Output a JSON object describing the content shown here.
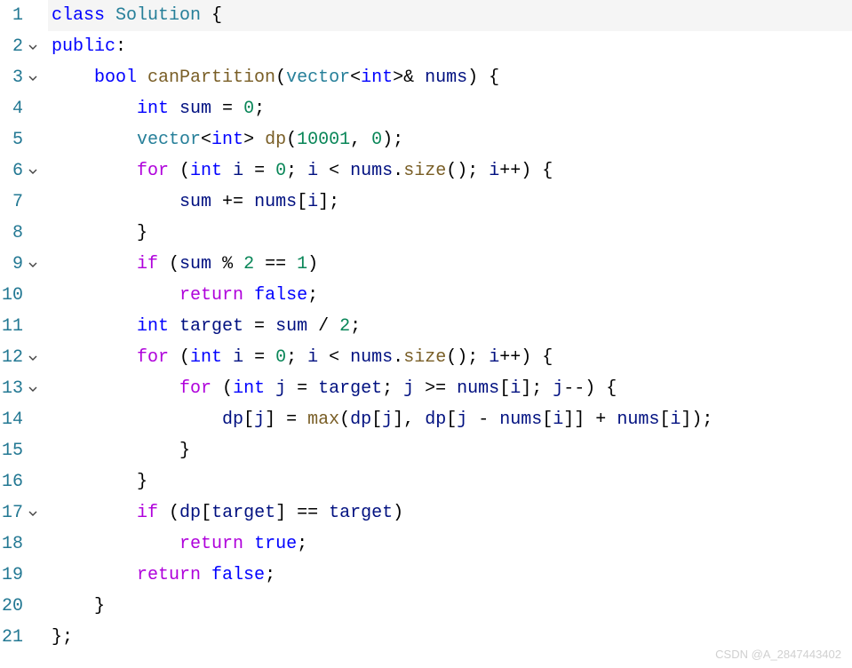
{
  "lines": [
    {
      "num": "1",
      "fold": "",
      "tokens": [
        {
          "t": "class ",
          "c": "kw"
        },
        {
          "t": "Solution",
          "c": "type"
        },
        {
          "t": " {",
          "c": "punct"
        }
      ],
      "hl": true
    },
    {
      "num": "2",
      "fold": "v",
      "tokens": [
        {
          "t": "public",
          "c": "kw"
        },
        {
          "t": ":",
          "c": "punct"
        }
      ]
    },
    {
      "num": "3",
      "fold": "v",
      "tokens": [
        {
          "t": "    ",
          "c": ""
        },
        {
          "t": "bool ",
          "c": "kw"
        },
        {
          "t": "canPartition",
          "c": "fn"
        },
        {
          "t": "(",
          "c": "punct"
        },
        {
          "t": "vector",
          "c": "type"
        },
        {
          "t": "<",
          "c": "punct"
        },
        {
          "t": "int",
          "c": "kw"
        },
        {
          "t": ">& ",
          "c": "punct"
        },
        {
          "t": "nums",
          "c": "var"
        },
        {
          "t": ") {",
          "c": "punct"
        }
      ]
    },
    {
      "num": "4",
      "fold": "",
      "tokens": [
        {
          "t": "        ",
          "c": ""
        },
        {
          "t": "int ",
          "c": "kw"
        },
        {
          "t": "sum",
          "c": "var"
        },
        {
          "t": " = ",
          "c": "op"
        },
        {
          "t": "0",
          "c": "num"
        },
        {
          "t": ";",
          "c": "punct"
        }
      ]
    },
    {
      "num": "5",
      "fold": "",
      "tokens": [
        {
          "t": "        ",
          "c": ""
        },
        {
          "t": "vector",
          "c": "type"
        },
        {
          "t": "<",
          "c": "punct"
        },
        {
          "t": "int",
          "c": "kw"
        },
        {
          "t": "> ",
          "c": "punct"
        },
        {
          "t": "dp",
          "c": "fn"
        },
        {
          "t": "(",
          "c": "punct"
        },
        {
          "t": "10001",
          "c": "num"
        },
        {
          "t": ", ",
          "c": "punct"
        },
        {
          "t": "0",
          "c": "num"
        },
        {
          "t": ");",
          "c": "punct"
        }
      ]
    },
    {
      "num": "6",
      "fold": "v",
      "tokens": [
        {
          "t": "        ",
          "c": ""
        },
        {
          "t": "for",
          "c": "ctrl"
        },
        {
          "t": " (",
          "c": "punct"
        },
        {
          "t": "int ",
          "c": "kw"
        },
        {
          "t": "i",
          "c": "var"
        },
        {
          "t": " = ",
          "c": "op"
        },
        {
          "t": "0",
          "c": "num"
        },
        {
          "t": "; ",
          "c": "punct"
        },
        {
          "t": "i",
          "c": "var"
        },
        {
          "t": " < ",
          "c": "op"
        },
        {
          "t": "nums",
          "c": "var"
        },
        {
          "t": ".",
          "c": "punct"
        },
        {
          "t": "size",
          "c": "fn"
        },
        {
          "t": "(); ",
          "c": "punct"
        },
        {
          "t": "i",
          "c": "var"
        },
        {
          "t": "++) {",
          "c": "punct"
        }
      ]
    },
    {
      "num": "7",
      "fold": "",
      "tokens": [
        {
          "t": "            ",
          "c": ""
        },
        {
          "t": "sum",
          "c": "var"
        },
        {
          "t": " += ",
          "c": "op"
        },
        {
          "t": "nums",
          "c": "var"
        },
        {
          "t": "[",
          "c": "punct"
        },
        {
          "t": "i",
          "c": "var"
        },
        {
          "t": "];",
          "c": "punct"
        }
      ]
    },
    {
      "num": "8",
      "fold": "",
      "tokens": [
        {
          "t": "        }",
          "c": "punct"
        }
      ]
    },
    {
      "num": "9",
      "fold": "v",
      "tokens": [
        {
          "t": "        ",
          "c": ""
        },
        {
          "t": "if",
          "c": "ctrl"
        },
        {
          "t": " (",
          "c": "punct"
        },
        {
          "t": "sum",
          "c": "var"
        },
        {
          "t": " % ",
          "c": "op"
        },
        {
          "t": "2",
          "c": "num"
        },
        {
          "t": " == ",
          "c": "op"
        },
        {
          "t": "1",
          "c": "num"
        },
        {
          "t": ")",
          "c": "punct"
        }
      ]
    },
    {
      "num": "10",
      "fold": "",
      "tokens": [
        {
          "t": "            ",
          "c": ""
        },
        {
          "t": "return",
          "c": "ctrl"
        },
        {
          "t": " ",
          "c": ""
        },
        {
          "t": "false",
          "c": "kw"
        },
        {
          "t": ";",
          "c": "punct"
        }
      ]
    },
    {
      "num": "11",
      "fold": "",
      "tokens": [
        {
          "t": "        ",
          "c": ""
        },
        {
          "t": "int ",
          "c": "kw"
        },
        {
          "t": "target",
          "c": "var"
        },
        {
          "t": " = ",
          "c": "op"
        },
        {
          "t": "sum",
          "c": "var"
        },
        {
          "t": " / ",
          "c": "op"
        },
        {
          "t": "2",
          "c": "num"
        },
        {
          "t": ";",
          "c": "punct"
        }
      ]
    },
    {
      "num": "12",
      "fold": "v",
      "tokens": [
        {
          "t": "        ",
          "c": ""
        },
        {
          "t": "for",
          "c": "ctrl"
        },
        {
          "t": " (",
          "c": "punct"
        },
        {
          "t": "int ",
          "c": "kw"
        },
        {
          "t": "i",
          "c": "var"
        },
        {
          "t": " = ",
          "c": "op"
        },
        {
          "t": "0",
          "c": "num"
        },
        {
          "t": "; ",
          "c": "punct"
        },
        {
          "t": "i",
          "c": "var"
        },
        {
          "t": " < ",
          "c": "op"
        },
        {
          "t": "nums",
          "c": "var"
        },
        {
          "t": ".",
          "c": "punct"
        },
        {
          "t": "size",
          "c": "fn"
        },
        {
          "t": "(); ",
          "c": "punct"
        },
        {
          "t": "i",
          "c": "var"
        },
        {
          "t": "++) {",
          "c": "punct"
        }
      ]
    },
    {
      "num": "13",
      "fold": "v",
      "tokens": [
        {
          "t": "            ",
          "c": ""
        },
        {
          "t": "for",
          "c": "ctrl"
        },
        {
          "t": " (",
          "c": "punct"
        },
        {
          "t": "int ",
          "c": "kw"
        },
        {
          "t": "j",
          "c": "var"
        },
        {
          "t": " = ",
          "c": "op"
        },
        {
          "t": "target",
          "c": "var"
        },
        {
          "t": "; ",
          "c": "punct"
        },
        {
          "t": "j",
          "c": "var"
        },
        {
          "t": " >= ",
          "c": "op"
        },
        {
          "t": "nums",
          "c": "var"
        },
        {
          "t": "[",
          "c": "punct"
        },
        {
          "t": "i",
          "c": "var"
        },
        {
          "t": "]; ",
          "c": "punct"
        },
        {
          "t": "j",
          "c": "var"
        },
        {
          "t": "--) {",
          "c": "punct"
        }
      ]
    },
    {
      "num": "14",
      "fold": "",
      "tokens": [
        {
          "t": "                ",
          "c": ""
        },
        {
          "t": "dp",
          "c": "var"
        },
        {
          "t": "[",
          "c": "punct"
        },
        {
          "t": "j",
          "c": "var"
        },
        {
          "t": "] = ",
          "c": "punct"
        },
        {
          "t": "max",
          "c": "fn"
        },
        {
          "t": "(",
          "c": "punct"
        },
        {
          "t": "dp",
          "c": "var"
        },
        {
          "t": "[",
          "c": "punct"
        },
        {
          "t": "j",
          "c": "var"
        },
        {
          "t": "], ",
          "c": "punct"
        },
        {
          "t": "dp",
          "c": "var"
        },
        {
          "t": "[",
          "c": "punct"
        },
        {
          "t": "j",
          "c": "var"
        },
        {
          "t": " - ",
          "c": "op"
        },
        {
          "t": "nums",
          "c": "var"
        },
        {
          "t": "[",
          "c": "punct"
        },
        {
          "t": "i",
          "c": "var"
        },
        {
          "t": "]] + ",
          "c": "punct"
        },
        {
          "t": "nums",
          "c": "var"
        },
        {
          "t": "[",
          "c": "punct"
        },
        {
          "t": "i",
          "c": "var"
        },
        {
          "t": "]);",
          "c": "punct"
        }
      ]
    },
    {
      "num": "15",
      "fold": "",
      "tokens": [
        {
          "t": "            }",
          "c": "punct"
        }
      ]
    },
    {
      "num": "16",
      "fold": "",
      "tokens": [
        {
          "t": "        }",
          "c": "punct"
        }
      ]
    },
    {
      "num": "17",
      "fold": "v",
      "tokens": [
        {
          "t": "        ",
          "c": ""
        },
        {
          "t": "if",
          "c": "ctrl"
        },
        {
          "t": " (",
          "c": "punct"
        },
        {
          "t": "dp",
          "c": "var"
        },
        {
          "t": "[",
          "c": "punct"
        },
        {
          "t": "target",
          "c": "var"
        },
        {
          "t": "] == ",
          "c": "punct"
        },
        {
          "t": "target",
          "c": "var"
        },
        {
          "t": ")",
          "c": "punct"
        }
      ]
    },
    {
      "num": "18",
      "fold": "",
      "tokens": [
        {
          "t": "            ",
          "c": ""
        },
        {
          "t": "return",
          "c": "ctrl"
        },
        {
          "t": " ",
          "c": ""
        },
        {
          "t": "true",
          "c": "kw"
        },
        {
          "t": ";",
          "c": "punct"
        }
      ]
    },
    {
      "num": "19",
      "fold": "",
      "tokens": [
        {
          "t": "        ",
          "c": ""
        },
        {
          "t": "return",
          "c": "ctrl"
        },
        {
          "t": " ",
          "c": ""
        },
        {
          "t": "false",
          "c": "kw"
        },
        {
          "t": ";",
          "c": "punct"
        }
      ]
    },
    {
      "num": "20",
      "fold": "",
      "tokens": [
        {
          "t": "    }",
          "c": "punct"
        }
      ]
    },
    {
      "num": "21",
      "fold": "",
      "tokens": [
        {
          "t": "};",
          "c": "punct"
        }
      ]
    }
  ],
  "watermark": "CSDN @A_2847443402"
}
